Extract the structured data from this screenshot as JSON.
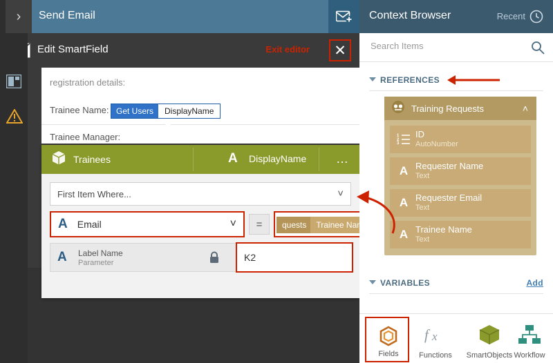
{
  "header": {
    "title": "Send Email",
    "chevron_icon": "chevron-right-icon",
    "badge_icon": "email-plus-icon"
  },
  "editor": {
    "title": "Edit SmartField",
    "env_icon": "envelope-icon",
    "exit_label": "Exit editor",
    "close_icon": "close-icon",
    "accent_red": "#cc2200"
  },
  "form_ghost": {
    "line1": "registration details:",
    "label_a": "Trainee Name:",
    "label_b": "Trainee Manager:"
  },
  "blue_token": {
    "part1": "Get Users",
    "part2": "DisplayName"
  },
  "card": {
    "object_icon": "smartobject-cube-icon",
    "object_name": "Trainees",
    "property_glyph": "A",
    "property_name": "DisplayName",
    "overflow_icon": "ellipsis-icon",
    "filter_text": "First Item Where...",
    "filter_chevron_icon": "chevron-down-icon",
    "condition_property": "Email",
    "condition_property_glyph": "A",
    "condition_chevron_icon": "chevron-down-icon",
    "operator": "=",
    "value_token": {
      "part1": "quests",
      "part2": "Trainee Name"
    },
    "parameter": {
      "glyph": "A",
      "name": "Label Name",
      "type": "Parameter",
      "lock_icon": "lock-icon",
      "value": "K2"
    }
  },
  "rail": {
    "items": [
      {
        "name": "layout-icon"
      },
      {
        "name": "warning-icon"
      }
    ]
  },
  "context_browser": {
    "title": "Context Browser",
    "recent_label": "Recent",
    "recent_icon": "clock-icon",
    "search": {
      "value": "",
      "placeholder": "Search Items",
      "icon": "search-icon"
    },
    "sections": [
      {
        "label": "REFERENCES"
      },
      {
        "label": "VARIABLES",
        "action": "Add"
      }
    ],
    "reference_card": {
      "name": "Training Requests",
      "icon": "smartobject-ref-icon",
      "collapse_icon": "chevron-up-icon",
      "fields": [
        {
          "glyph": "123",
          "name": "ID",
          "type": "AutoNumber"
        },
        {
          "glyph": "A",
          "name": "Requester Name",
          "type": "Text"
        },
        {
          "glyph": "A",
          "name": "Requester Email",
          "type": "Text"
        },
        {
          "glyph": "A",
          "name": "Trainee Name",
          "type": "Text"
        }
      ]
    }
  },
  "tabs": [
    {
      "label": "Fields",
      "icon": "fields-icon",
      "selected": true
    },
    {
      "label": "Functions",
      "icon": "fx-icon",
      "selected": false
    },
    {
      "label": "SmartObjects",
      "icon": "smartobjects-cube-icon",
      "selected": false
    },
    {
      "label": "Workflow",
      "icon": "workflow-icon",
      "selected": false
    }
  ]
}
